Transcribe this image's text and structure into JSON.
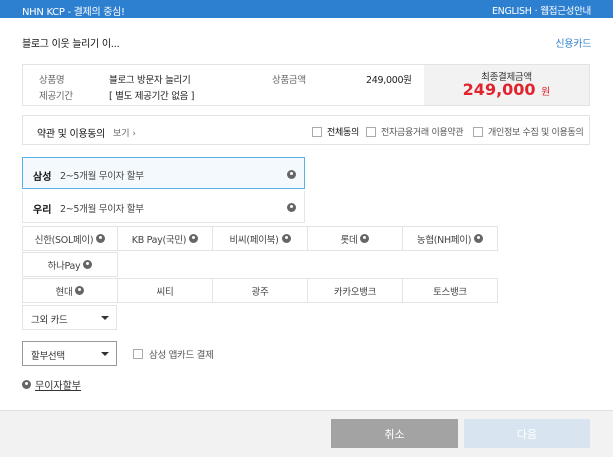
{
  "header": {
    "logo": "NHN KCP - 결제의 중심!",
    "english": "ENGLISH",
    "separator": "·",
    "help": "웹접근성안내"
  },
  "product": {
    "short_name": "블로그 이웃 늘리기 이...",
    "payment_method": "신용카드",
    "name_label": "상품명",
    "name_value": "블로그 방문자 늘리기",
    "period_label": "제공기간",
    "period_value": "[ 별도 제공기간 없음 ]",
    "amount_label": "상품금액",
    "amount_value": "249,000원",
    "final_label": "최종결제금액",
    "final_value": "249,000",
    "final_unit": "원"
  },
  "terms": {
    "title": "약관 및 이용동의",
    "view": "보기 ›",
    "all_agree": "전체동의",
    "efinance": "전자금융거래 이용약관",
    "privacy": "개인정보 수집 및 이용동의"
  },
  "promo_cards": [
    {
      "name": "삼성",
      "desc": "2~5개월 무이자 할부",
      "selected": true
    },
    {
      "name": "우리",
      "desc": "2~5개월 무이자 할부",
      "selected": false
    }
  ],
  "card_row1": [
    "신한(SOL페이)",
    "KB Pay(국민)",
    "비씨(페이북)",
    "롯데",
    "농협(NH페이)"
  ],
  "card_row2": [
    "하나Pay"
  ],
  "card_row3": [
    "현대",
    "씨티",
    "광주",
    "카카오뱅크",
    "토스뱅크"
  ],
  "other_card_select": "그외 카드",
  "installment_select": "할부선택",
  "samsung_appcard": "삼성 앱카드 결제",
  "no_interest_link": "무이자할부",
  "buttons": {
    "cancel": "취소",
    "next": "다음"
  },
  "colors": {
    "topbar": "#2d7fcf",
    "final_price": "#e0242e",
    "selected_border": "#5ab0e8",
    "cancel_button": "#a3a3a3",
    "next_button_disabled": "#d8e4ef"
  }
}
